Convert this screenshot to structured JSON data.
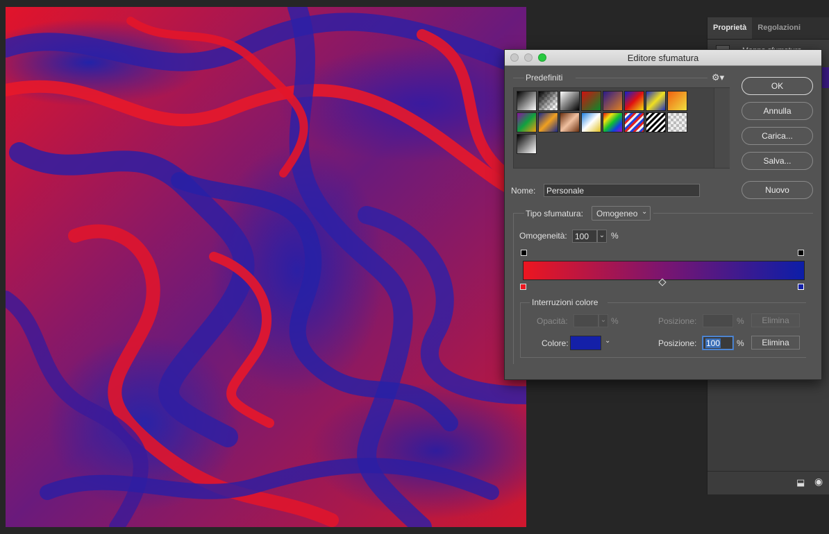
{
  "properties_panel": {
    "tabs": [
      "Proprietà",
      "Regolazioni"
    ],
    "layer_label": "Mappa sfumatura"
  },
  "dialog": {
    "title": "Editore sfumatura",
    "presets": {
      "label": "Predefiniti",
      "gear_icon": "gear-icon"
    },
    "buttons": {
      "ok": "OK",
      "cancel": "Annulla",
      "load": "Carica...",
      "save": "Salva...",
      "new": "Nuovo"
    },
    "name": {
      "label": "Nome:",
      "value": "Personale"
    },
    "gradient_type": {
      "label": "Tipo sfumatura:",
      "value": "Omogeneo"
    },
    "smoothness": {
      "label": "Omogeneità:",
      "value": "100",
      "unit": "%"
    },
    "color_stops": {
      "label": "Interruzioni colore",
      "opacity_label": "Opacità:",
      "opacity_value": "",
      "opacity_unit": "%",
      "position_label": "Posizione:",
      "position_unit": "%",
      "delete_label": "Elimina",
      "color_label": "Colore:",
      "color_value": "#1420a8",
      "color_position_value": "100",
      "gradient_start_color": "#ec1620",
      "gradient_end_color": "#0c1ea8"
    }
  },
  "colors": {
    "canvas_red": "#e2142a",
    "canvas_blue": "#2a23a6"
  }
}
